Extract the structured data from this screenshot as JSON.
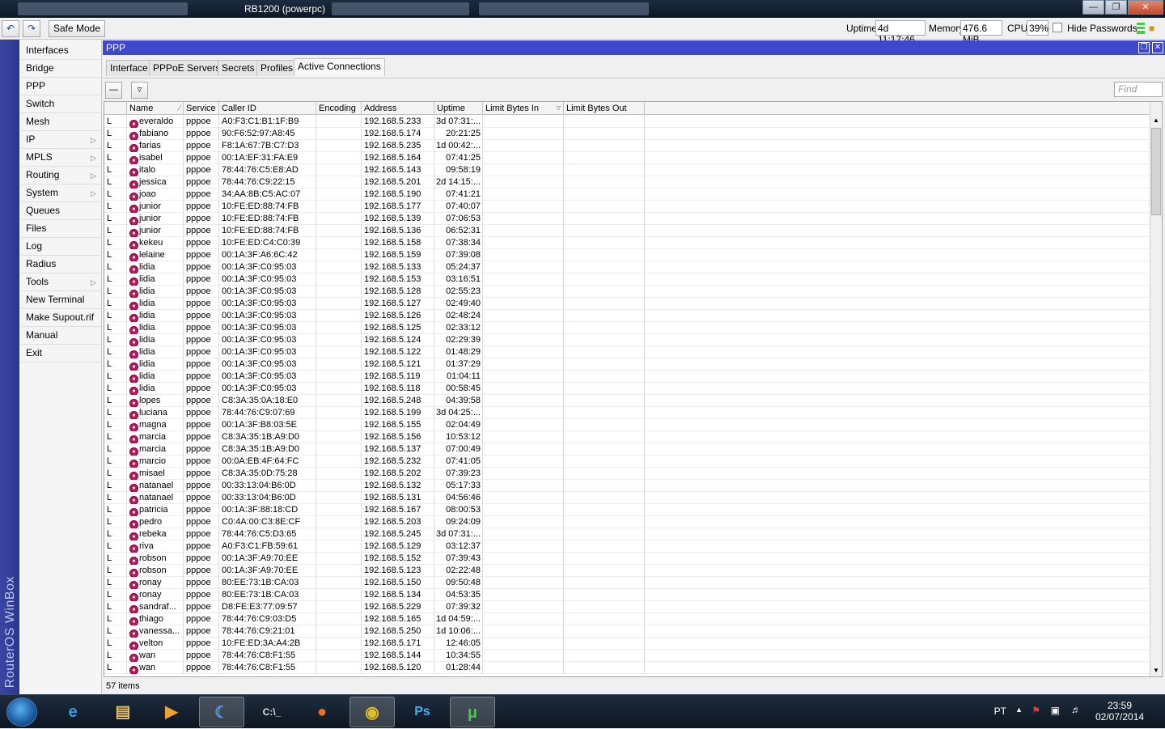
{
  "window": {
    "title": "RB1200 (powerpc)"
  },
  "toolbar": {
    "undo_icon": "undo-icon",
    "redo_icon": "redo-icon",
    "safe_mode": "Safe Mode",
    "uptime_label": "Uptime:",
    "uptime_value": "4d 11:17:46",
    "memory_label": "Memory:",
    "memory_value": "476.6 MiB",
    "cpu_label": "CPU:",
    "cpu_value": "39%",
    "hide_passwords": "Hide Passwords"
  },
  "brand": "RouterOS WinBox",
  "menu": {
    "items": [
      {
        "label": "Interfaces",
        "sub": false
      },
      {
        "label": "Bridge",
        "sub": false
      },
      {
        "label": "PPP",
        "sub": false
      },
      {
        "label": "Switch",
        "sub": false
      },
      {
        "label": "Mesh",
        "sub": false
      },
      {
        "label": "IP",
        "sub": true
      },
      {
        "label": "MPLS",
        "sub": true
      },
      {
        "label": "Routing",
        "sub": true
      },
      {
        "label": "System",
        "sub": true
      },
      {
        "label": "Queues",
        "sub": false
      },
      {
        "label": "Files",
        "sub": false
      },
      {
        "label": "Log",
        "sub": false
      },
      {
        "label": "Radius",
        "sub": false
      },
      {
        "label": "Tools",
        "sub": true
      },
      {
        "label": "New Terminal",
        "sub": false
      },
      {
        "label": "Make Supout.rif",
        "sub": false
      },
      {
        "label": "Manual",
        "sub": false
      },
      {
        "label": "Exit",
        "sub": false
      }
    ]
  },
  "ppp": {
    "title": "PPP",
    "tabs": [
      "Interface",
      "PPPoE Servers",
      "Secrets",
      "Profiles",
      "Active Connections"
    ],
    "active_tab": "Active Connections",
    "find_placeholder": "Find",
    "columns": [
      "",
      "Name",
      "Service",
      "Caller ID",
      "Encoding",
      "Address",
      "Uptime",
      "Limit Bytes In",
      "Limit Bytes Out"
    ],
    "rows": [
      [
        "L",
        "everaldo",
        "pppoe",
        "A0:F3:C1:B1:1F:B9",
        "",
        "192.168.5.233",
        "3d 07:31:..."
      ],
      [
        "L",
        "fabiano",
        "pppoe",
        "90:F6:52:97:A8:45",
        "",
        "192.168.5.174",
        "20:21:25"
      ],
      [
        "L",
        "farias",
        "pppoe",
        "F8:1A:67:7B:C7:D3",
        "",
        "192.168.5.235",
        "1d 00:42:..."
      ],
      [
        "L",
        "isabel",
        "pppoe",
        "00:1A:EF:31:FA:E9",
        "",
        "192.168.5.164",
        "07:41:25"
      ],
      [
        "L",
        "italo",
        "pppoe",
        "78:44:76:C5:E8:AD",
        "",
        "192.168.5.143",
        "09:58:19"
      ],
      [
        "L",
        "jessica",
        "pppoe",
        "78:44:76:C9:22:15",
        "",
        "192.168.5.201",
        "2d 14:15:..."
      ],
      [
        "L",
        "joao",
        "pppoe",
        "34:AA:8B:C5:AC:07",
        "",
        "192.168.5.190",
        "07:41:21"
      ],
      [
        "L",
        "junior",
        "pppoe",
        "10:FE:ED:88:74:FB",
        "",
        "192.168.5.177",
        "07:40:07"
      ],
      [
        "L",
        "junior",
        "pppoe",
        "10:FE:ED:88:74:FB",
        "",
        "192.168.5.139",
        "07:06:53"
      ],
      [
        "L",
        "junior",
        "pppoe",
        "10:FE:ED:88:74:FB",
        "",
        "192.168.5.136",
        "06:52:31"
      ],
      [
        "L",
        "kekeu",
        "pppoe",
        "10:FE:ED:C4:C0:39",
        "",
        "192.168.5.158",
        "07:38:34"
      ],
      [
        "L",
        "lelaine",
        "pppoe",
        "00:1A:3F:A6:6C:42",
        "",
        "192.168.5.159",
        "07:39:08"
      ],
      [
        "L",
        "lidia",
        "pppoe",
        "00:1A:3F:C0:95:03",
        "",
        "192.168.5.133",
        "05:24:37"
      ],
      [
        "L",
        "lidia",
        "pppoe",
        "00:1A:3F:C0:95:03",
        "",
        "192.168.5.153",
        "03:16:51"
      ],
      [
        "L",
        "lidia",
        "pppoe",
        "00:1A:3F:C0:95:03",
        "",
        "192.168.5.128",
        "02:55:23"
      ],
      [
        "L",
        "lidia",
        "pppoe",
        "00:1A:3F:C0:95:03",
        "",
        "192.168.5.127",
        "02:49:40"
      ],
      [
        "L",
        "lidia",
        "pppoe",
        "00:1A:3F:C0:95:03",
        "",
        "192.168.5.126",
        "02:48:24"
      ],
      [
        "L",
        "lidia",
        "pppoe",
        "00:1A:3F:C0:95:03",
        "",
        "192.168.5.125",
        "02:33:12"
      ],
      [
        "L",
        "lidia",
        "pppoe",
        "00:1A:3F:C0:95:03",
        "",
        "192.168.5.124",
        "02:29:39"
      ],
      [
        "L",
        "lidia",
        "pppoe",
        "00:1A:3F:C0:95:03",
        "",
        "192.168.5.122",
        "01:48:29"
      ],
      [
        "L",
        "lidia",
        "pppoe",
        "00:1A:3F:C0:95:03",
        "",
        "192.168.5.121",
        "01:37:29"
      ],
      [
        "L",
        "lidia",
        "pppoe",
        "00:1A:3F:C0:95:03",
        "",
        "192.168.5.119",
        "01:04:11"
      ],
      [
        "L",
        "lidia",
        "pppoe",
        "00:1A:3F:C0:95:03",
        "",
        "192.168.5.118",
        "00:58:45"
      ],
      [
        "L",
        "lopes",
        "pppoe",
        "C8:3A:35:0A:18:E0",
        "",
        "192.168.5.248",
        "04:39:58"
      ],
      [
        "L",
        "luciana",
        "pppoe",
        "78:44:76:C9:07:69",
        "",
        "192.168.5.199",
        "3d 04:25:..."
      ],
      [
        "L",
        "magna",
        "pppoe",
        "00:1A:3F:B8:03:5E",
        "",
        "192.168.5.155",
        "02:04:49"
      ],
      [
        "L",
        "marcia",
        "pppoe",
        "C8:3A:35:1B:A9:D0",
        "",
        "192.168.5.156",
        "10:53:12"
      ],
      [
        "L",
        "marcia",
        "pppoe",
        "C8:3A:35:1B:A9:D0",
        "",
        "192.168.5.137",
        "07:00:49"
      ],
      [
        "L",
        "marcio",
        "pppoe",
        "00:0A:EB:4F:64:FC",
        "",
        "192.168.5.232",
        "07:41:05"
      ],
      [
        "L",
        "misael",
        "pppoe",
        "C8:3A:35:0D:75:28",
        "",
        "192.168.5.202",
        "07:39:23"
      ],
      [
        "L",
        "natanael",
        "pppoe",
        "00:33:13:04:B6:0D",
        "",
        "192.168.5.132",
        "05:17:33"
      ],
      [
        "L",
        "natanael",
        "pppoe",
        "00:33:13:04:B6:0D",
        "",
        "192.168.5.131",
        "04:56:46"
      ],
      [
        "L",
        "patricia",
        "pppoe",
        "00:1A:3F:88:18:CD",
        "",
        "192.168.5.167",
        "08:00:53"
      ],
      [
        "L",
        "pedro",
        "pppoe",
        "C0:4A:00:C3:8E:CF",
        "",
        "192.168.5.203",
        "09:24:09"
      ],
      [
        "L",
        "rebeka",
        "pppoe",
        "78:44:76:C5:D3:65",
        "",
        "192.168.5.245",
        "3d 07:31:..."
      ],
      [
        "L",
        "riva",
        "pppoe",
        "A0:F3:C1:FB:59:61",
        "",
        "192.168.5.129",
        "03:12:37"
      ],
      [
        "L",
        "robson",
        "pppoe",
        "00:1A:3F:A9:70:EE",
        "",
        "192.168.5.152",
        "07:39:43"
      ],
      [
        "L",
        "robson",
        "pppoe",
        "00:1A:3F:A9:70:EE",
        "",
        "192.168.5.123",
        "02:22:48"
      ],
      [
        "L",
        "ronay",
        "pppoe",
        "80:EE:73:1B:CA:03",
        "",
        "192.168.5.150",
        "09:50:48"
      ],
      [
        "L",
        "ronay",
        "pppoe",
        "80:EE:73:1B:CA:03",
        "",
        "192.168.5.134",
        "04:53:35"
      ],
      [
        "L",
        "sandraf...",
        "pppoe",
        "D8:FE:E3:77:09:57",
        "",
        "192.168.5.229",
        "07:39:32"
      ],
      [
        "L",
        "thiago",
        "pppoe",
        "78:44:76:C9:03:D5",
        "",
        "192.168.5.165",
        "1d 04:59:..."
      ],
      [
        "L",
        "vanessa...",
        "pppoe",
        "78:44:76:C9:21:01",
        "",
        "192.168.5.250",
        "1d 10:06:..."
      ],
      [
        "L",
        "velton",
        "pppoe",
        "10:FE:ED:3A:A4:2B",
        "",
        "192.168.5.171",
        "12:46:05"
      ],
      [
        "L",
        "wan",
        "pppoe",
        "78:44:76:C8:F1:55",
        "",
        "192.168.5.144",
        "10:34:55"
      ],
      [
        "L",
        "wan",
        "pppoe",
        "78:44:76:C8:F1:55",
        "",
        "192.168.5.120",
        "01:28:44"
      ]
    ],
    "status": "57 items"
  },
  "taskbar": {
    "apps": [
      "internet-explorer",
      "file-explorer",
      "media-player",
      "winbox",
      "command-prompt",
      "firefox",
      "chrome",
      "photoshop",
      "utorrent"
    ],
    "lang": "PT",
    "time": "23:59",
    "date": "02/07/2014"
  }
}
